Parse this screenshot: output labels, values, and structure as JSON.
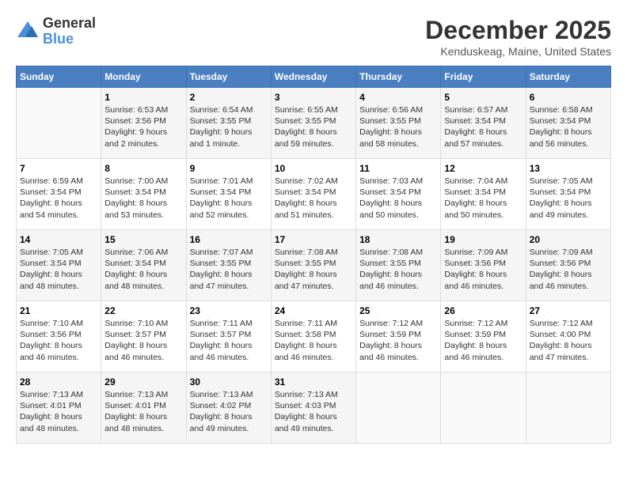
{
  "logo": {
    "general": "General",
    "blue": "Blue"
  },
  "title": "December 2025",
  "subtitle": "Kenduskeag, Maine, United States",
  "days_of_week": [
    "Sunday",
    "Monday",
    "Tuesday",
    "Wednesday",
    "Thursday",
    "Friday",
    "Saturday"
  ],
  "weeks": [
    [
      {
        "day": "",
        "info": ""
      },
      {
        "day": "1",
        "info": "Sunrise: 6:53 AM\nSunset: 3:56 PM\nDaylight: 9 hours\nand 2 minutes."
      },
      {
        "day": "2",
        "info": "Sunrise: 6:54 AM\nSunset: 3:55 PM\nDaylight: 9 hours\nand 1 minute."
      },
      {
        "day": "3",
        "info": "Sunrise: 6:55 AM\nSunset: 3:55 PM\nDaylight: 8 hours\nand 59 minutes."
      },
      {
        "day": "4",
        "info": "Sunrise: 6:56 AM\nSunset: 3:55 PM\nDaylight: 8 hours\nand 58 minutes."
      },
      {
        "day": "5",
        "info": "Sunrise: 6:57 AM\nSunset: 3:54 PM\nDaylight: 8 hours\nand 57 minutes."
      },
      {
        "day": "6",
        "info": "Sunrise: 6:58 AM\nSunset: 3:54 PM\nDaylight: 8 hours\nand 56 minutes."
      }
    ],
    [
      {
        "day": "7",
        "info": "Sunrise: 6:59 AM\nSunset: 3:54 PM\nDaylight: 8 hours\nand 54 minutes."
      },
      {
        "day": "8",
        "info": "Sunrise: 7:00 AM\nSunset: 3:54 PM\nDaylight: 8 hours\nand 53 minutes."
      },
      {
        "day": "9",
        "info": "Sunrise: 7:01 AM\nSunset: 3:54 PM\nDaylight: 8 hours\nand 52 minutes."
      },
      {
        "day": "10",
        "info": "Sunrise: 7:02 AM\nSunset: 3:54 PM\nDaylight: 8 hours\nand 51 minutes."
      },
      {
        "day": "11",
        "info": "Sunrise: 7:03 AM\nSunset: 3:54 PM\nDaylight: 8 hours\nand 50 minutes."
      },
      {
        "day": "12",
        "info": "Sunrise: 7:04 AM\nSunset: 3:54 PM\nDaylight: 8 hours\nand 50 minutes."
      },
      {
        "day": "13",
        "info": "Sunrise: 7:05 AM\nSunset: 3:54 PM\nDaylight: 8 hours\nand 49 minutes."
      }
    ],
    [
      {
        "day": "14",
        "info": "Sunrise: 7:05 AM\nSunset: 3:54 PM\nDaylight: 8 hours\nand 48 minutes."
      },
      {
        "day": "15",
        "info": "Sunrise: 7:06 AM\nSunset: 3:54 PM\nDaylight: 8 hours\nand 48 minutes."
      },
      {
        "day": "16",
        "info": "Sunrise: 7:07 AM\nSunset: 3:55 PM\nDaylight: 8 hours\nand 47 minutes."
      },
      {
        "day": "17",
        "info": "Sunrise: 7:08 AM\nSunset: 3:55 PM\nDaylight: 8 hours\nand 47 minutes."
      },
      {
        "day": "18",
        "info": "Sunrise: 7:08 AM\nSunset: 3:55 PM\nDaylight: 8 hours\nand 46 minutes."
      },
      {
        "day": "19",
        "info": "Sunrise: 7:09 AM\nSunset: 3:56 PM\nDaylight: 8 hours\nand 46 minutes."
      },
      {
        "day": "20",
        "info": "Sunrise: 7:09 AM\nSunset: 3:56 PM\nDaylight: 8 hours\nand 46 minutes."
      }
    ],
    [
      {
        "day": "21",
        "info": "Sunrise: 7:10 AM\nSunset: 3:56 PM\nDaylight: 8 hours\nand 46 minutes."
      },
      {
        "day": "22",
        "info": "Sunrise: 7:10 AM\nSunset: 3:57 PM\nDaylight: 8 hours\nand 46 minutes."
      },
      {
        "day": "23",
        "info": "Sunrise: 7:11 AM\nSunset: 3:57 PM\nDaylight: 8 hours\nand 46 minutes."
      },
      {
        "day": "24",
        "info": "Sunrise: 7:11 AM\nSunset: 3:58 PM\nDaylight: 8 hours\nand 46 minutes."
      },
      {
        "day": "25",
        "info": "Sunrise: 7:12 AM\nSunset: 3:59 PM\nDaylight: 8 hours\nand 46 minutes."
      },
      {
        "day": "26",
        "info": "Sunrise: 7:12 AM\nSunset: 3:59 PM\nDaylight: 8 hours\nand 46 minutes."
      },
      {
        "day": "27",
        "info": "Sunrise: 7:12 AM\nSunset: 4:00 PM\nDaylight: 8 hours\nand 47 minutes."
      }
    ],
    [
      {
        "day": "28",
        "info": "Sunrise: 7:13 AM\nSunset: 4:01 PM\nDaylight: 8 hours\nand 48 minutes."
      },
      {
        "day": "29",
        "info": "Sunrise: 7:13 AM\nSunset: 4:01 PM\nDaylight: 8 hours\nand 48 minutes."
      },
      {
        "day": "30",
        "info": "Sunrise: 7:13 AM\nSunset: 4:02 PM\nDaylight: 8 hours\nand 49 minutes."
      },
      {
        "day": "31",
        "info": "Sunrise: 7:13 AM\nSunset: 4:03 PM\nDaylight: 8 hours\nand 49 minutes."
      },
      {
        "day": "",
        "info": ""
      },
      {
        "day": "",
        "info": ""
      },
      {
        "day": "",
        "info": ""
      }
    ]
  ]
}
